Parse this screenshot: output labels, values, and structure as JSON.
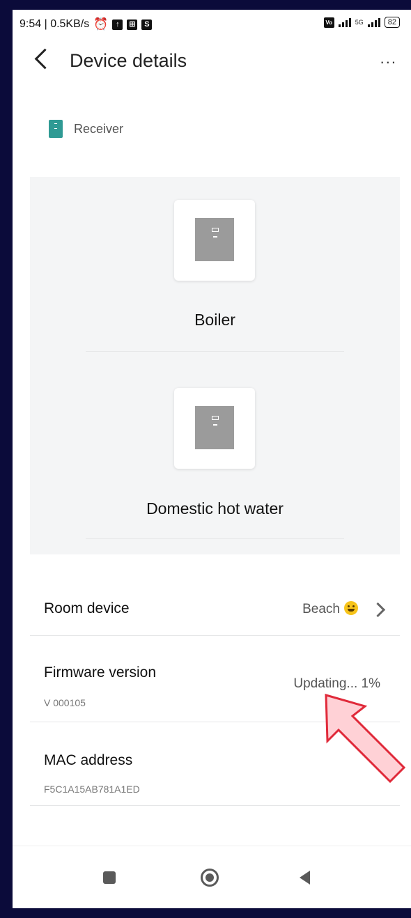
{
  "status_bar": {
    "time_speed": "9:54 | 0.5KB/s",
    "sim_label": "S",
    "network_5g": "5G",
    "battery": "82"
  },
  "header": {
    "title": "Device details",
    "more_label": "..."
  },
  "receiver": {
    "label": "Receiver"
  },
  "devices": [
    {
      "name": "Boiler"
    },
    {
      "name": "Domestic hot water"
    }
  ],
  "rows": {
    "room_device": {
      "label": "Room device",
      "value": "Beach"
    },
    "firmware": {
      "label": "Firmware version",
      "sub": "V 000105",
      "value": "Updating... 1%"
    },
    "mac": {
      "label": "MAC address",
      "sub": "F5C1A15AB781A1ED"
    }
  },
  "colors": {
    "frame": "#0b0b3a",
    "receiver_icon": "#2f9a94",
    "device_icon": "#9b9b9b",
    "annotation_arrow": "#e02a3a"
  },
  "icons": {
    "back": "chevron-left-icon",
    "more": "more-horizontal-icon",
    "room_chevron": "chevron-right-icon",
    "smiley": "smiley-emoji-icon"
  }
}
